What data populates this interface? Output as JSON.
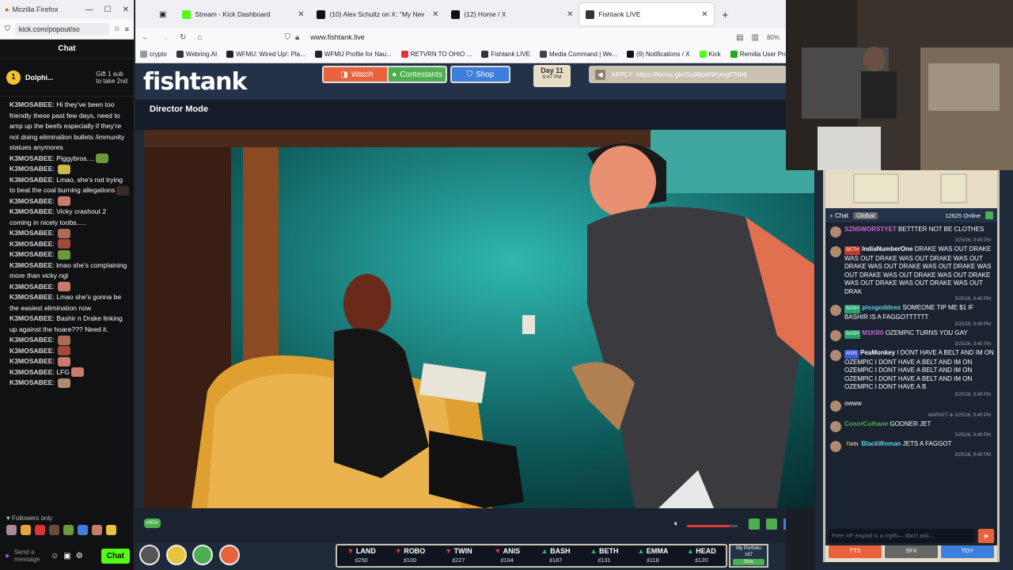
{
  "popout": {
    "window_title": "Mozilla Firefox",
    "url": "kick.com/popout/so",
    "chat_header": "Chat",
    "pinned": {
      "name": "Dolphi...",
      "count": "1",
      "gift_line1": "Gift 1 sub",
      "gift_line2": "to take 2nd"
    },
    "messages": [
      {
        "user": "K3MOSABEE",
        "text": "Hi they've been too friendly these past few days, need to amp up the beefs especially if they're not doing elimination bullets /immunity statues anymores",
        "emote": ""
      },
      {
        "user": "K3MOSABEE",
        "text": "Piggybros....",
        "emote": "#6a9a3a"
      },
      {
        "user": "K3MOSABEE",
        "text": "",
        "emote": "#c9b84a"
      },
      {
        "user": "K3MOSABEE",
        "text": "Lmao, she's not trying to beat the coal burning allegations",
        "emote": "#3a2a2a"
      },
      {
        "user": "K3MOSABEE",
        "text": "",
        "emote": "#c97a6a"
      },
      {
        "user": "K3MOSABEE",
        "text": "Vicky crashout 2 coming in nicely toobs.....",
        "emote": ""
      },
      {
        "user": "K3MOSABEE",
        "text": "",
        "emote": "#b06a5a"
      },
      {
        "user": "K3MOSABEE",
        "text": "",
        "emote": "#a04a3a"
      },
      {
        "user": "K3MOSABEE",
        "text": "",
        "emote": "#6a9a3a"
      },
      {
        "user": "K3MOSABEE",
        "text": "lmao she's complaining more than vicky ngl",
        "emote": ""
      },
      {
        "user": "K3MOSABEE",
        "text": "",
        "emote": "#c97a6a"
      },
      {
        "user": "K3MOSABEE",
        "text": "Lmao she's gonna be the easiest elimination now",
        "emote": ""
      },
      {
        "user": "K3MOSABEE",
        "text": "Bashir n Drake linking up against the hoare??? Need it.",
        "emote": ""
      },
      {
        "user": "K3MOSABEE",
        "text": "",
        "emote": "#b06a5a"
      },
      {
        "user": "K3MOSABEE",
        "text": "",
        "emote": "#a04a3a"
      },
      {
        "user": "K3MOSABEE",
        "text": "",
        "emote": "#c97a6a"
      },
      {
        "user": "K3MOSABEE",
        "text": "LFG",
        "emote": "#c97a6a"
      },
      {
        "user": "K3MOSABEE",
        "text": "",
        "emote": "#b08a70"
      }
    ],
    "followers_only": "Followers only",
    "send_placeholder": "Send a message",
    "chat_button": "Chat"
  },
  "browser": {
    "tabs": [
      {
        "label": "Stream - Kick Dashboard",
        "color": "#53fc18"
      },
      {
        "label": "(10) Alex Schultz on X: \"My New",
        "color": "#111"
      },
      {
        "label": "(12) Home / X",
        "color": "#111"
      },
      {
        "label": "Fishtank LIVE",
        "color": "#333"
      }
    ],
    "address": "www.fishtank.live",
    "zoom": "80%",
    "bookmarks": [
      {
        "label": "crypto",
        "color": "#999"
      },
      {
        "label": "Webring.AI",
        "color": "#333"
      },
      {
        "label": "WFMU: Wired Up!: Pla...",
        "color": "#222"
      },
      {
        "label": "WFMU Profile for Nau...",
        "color": "#222"
      },
      {
        "label": "RETVRN TO OHIO ...",
        "color": "#d33"
      },
      {
        "label": "Fishtank LIVE",
        "color": "#333"
      },
      {
        "label": "Media Command | We...",
        "color": "#444"
      },
      {
        "label": "(9) Notifications / X",
        "color": "#111"
      },
      {
        "label": "Kick",
        "color": "#53fc18"
      },
      {
        "label": "Remilia User Profiles",
        "color": "#2a2"
      }
    ]
  },
  "fishtank": {
    "logo": "fishtank",
    "nav": [
      {
        "label": "Watch",
        "color": "#e8623d"
      },
      {
        "label": "Contestants",
        "color": "#4caf50"
      },
      {
        "label": "Shop",
        "color": "#3f7fdc"
      }
    ],
    "day": "Day 11",
    "time": "9:47 PM",
    "apply": "APPLY: https://forms.gle/Sq89p6NKjmgf7Nh8",
    "director_mode": "Director Mode",
    "quality": "HIGH",
    "stats": [
      {
        "name": "LAND",
        "value": "250",
        "dir": "down"
      },
      {
        "name": "ROBO",
        "value": "100",
        "dir": "down"
      },
      {
        "name": "TWIN",
        "value": "227",
        "dir": "down"
      },
      {
        "name": "ANIS",
        "value": "104",
        "dir": "down"
      },
      {
        "name": "BASH",
        "value": "187",
        "dir": "up"
      },
      {
        "name": "BETH",
        "value": "131",
        "dir": "up"
      },
      {
        "name": "EMMA",
        "value": "118",
        "dir": "up"
      },
      {
        "name": "HEAD",
        "value": "120",
        "dir": "up"
      }
    ],
    "portfolio": {
      "title": "My Portfolio",
      "value": "167",
      "button": "Stox"
    },
    "volume": 0.85
  },
  "right_chat": {
    "tab": "Chat",
    "filter": "Global",
    "online": "12625 Online",
    "messages": [
      {
        "user": "SZN5WORSTYET",
        "text": "BETTTER NOT BE CLOTHES",
        "color": "#c86ad6",
        "tag": "",
        "tag_color": "",
        "time": "3/25/26, 9:49 PM"
      },
      {
        "user": "IndiaNumberOne",
        "text": "DRAKE WAS OUT DRAKE WAS OUT DRAKE WAS OUT DRAKE WAS OUT DRAKE WAS OUT DRAKE WAS OUT DRAKE WAS OUT DRAKE WAS OUT DRAKE WAS OUT DRAKE WAS OUT DRAKE WAS OUT DRAKE WAS OUT DRAK",
        "color": "#ffffff",
        "tag": "BETH",
        "tag_color": "#c0392b",
        "time": "3/25/26, 9:49 PM"
      },
      {
        "user": "pissgoddess",
        "text": "SOMEONE TIP ME $1 IF BASHIR IS A FAGGOTTTTTT",
        "color": "#5fd3e6",
        "tag": "BASH",
        "tag_color": "#27a36a",
        "time": "3/25/26, 9:49 PM"
      },
      {
        "user": "M1KR0",
        "text": "OZEMPIC TURNS YOU GAY",
        "color": "#c86ad6",
        "tag": "BASH",
        "tag_color": "#27a36a",
        "time": "3/25/26, 9:49 PM"
      },
      {
        "user": "PeaMonkey",
        "text": "I DONT HAVE A BELT AND IM ON OZEMPIC I DONT HAVE A BELT AND IM ON OZEMPIC I DONT HAVE A BELT AND IM ON OZEMPIC I DONT HAVE A BELT AND IM ON OZEMPIC I DONT HAVE A B",
        "color": "#ffffff",
        "tag": "ANIS",
        "tag_color": "#3b5bdb",
        "time": "3/25/26, 9:49 PM"
      },
      {
        "user": "",
        "text": "owww",
        "color": "#ffffff",
        "tag": "",
        "tag_color": "",
        "time": "MARKET ⊕ 3/25/26, 9:49 PM"
      },
      {
        "user": "ConorCulhane",
        "text": "GOONER JET",
        "color": "#4caf50",
        "tag": "",
        "tag_color": "",
        "time": "3/25/26, 9:49 PM"
      },
      {
        "user": "BlackWoman",
        "text": "JETS A FAGGOT",
        "color": "#5fd3e6",
        "tag": "TWIN",
        "tag_color": "#222",
        "time": "3/25/26, 9:49 PM"
      }
    ],
    "input_placeholder": "Free XP exploit is a myth— don't ask...",
    "buttons": [
      {
        "label": "TTS",
        "color": "#e8623d"
      },
      {
        "label": "SFX",
        "color": "#666"
      },
      {
        "label": "TOY",
        "color": "#3f7fdc"
      }
    ]
  }
}
